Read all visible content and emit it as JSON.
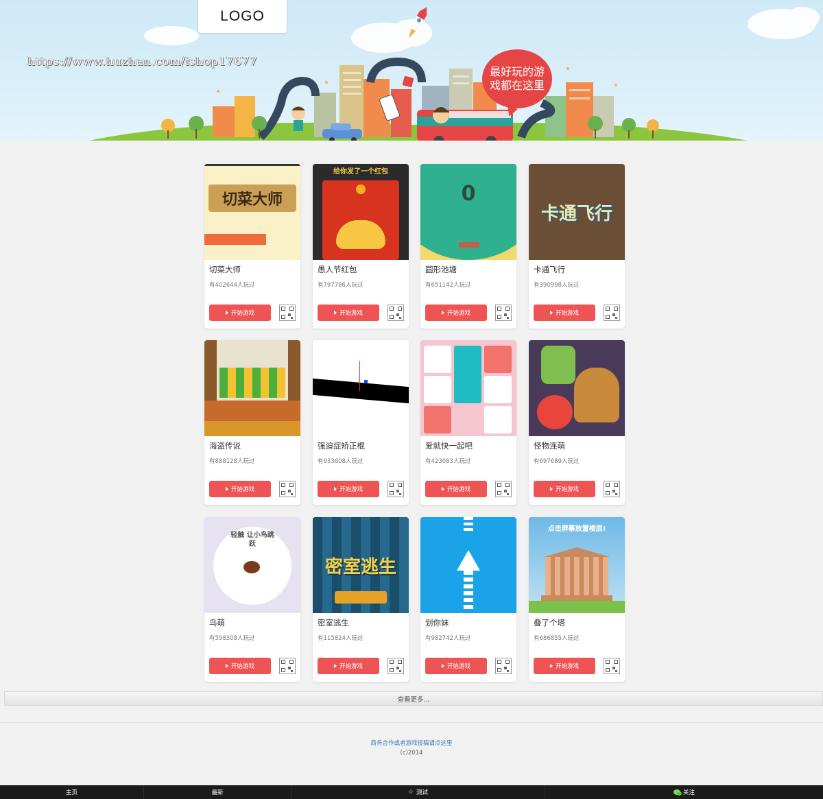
{
  "header": {
    "logo_text": "LOGO",
    "watermark": "https://www.huzhan.com/ishop17677",
    "slogan": "最好玩的游戏都在这里"
  },
  "colors": {
    "accent_red": "#ee5454",
    "banner_sky": "#d9eff9",
    "nav_bg": "#1b1b1b"
  },
  "games": [
    {
      "title": "切菜大师",
      "plays": "有402644人玩过",
      "button": "开始游戏",
      "thumb_text": "切菜大师"
    },
    {
      "title": "愚人节红包",
      "plays": "有797786人玩过",
      "button": "开始游戏",
      "thumb_text": "给你发了一个红包"
    },
    {
      "title": "圆形池塘",
      "plays": "有651142人玩过",
      "button": "开始游戏",
      "thumb_text": "0"
    },
    {
      "title": "卡通飞行",
      "plays": "有390998人玩过",
      "button": "开始游戏",
      "thumb_text": "卡通飞行"
    },
    {
      "title": "海盗传说",
      "plays": "有888128人玩过",
      "button": "开始游戏",
      "thumb_text": ""
    },
    {
      "title": "强迫症矫正棍",
      "plays": "有933608人玩过",
      "button": "开始游戏",
      "thumb_text": ""
    },
    {
      "title": "爱就快一起吧",
      "plays": "有423083人玩过",
      "button": "开始游戏",
      "thumb_text": ""
    },
    {
      "title": "怪物连萌",
      "plays": "有697689人玩过",
      "button": "开始游戏",
      "thumb_text": ""
    },
    {
      "title": "鸟萌",
      "plays": "有598308人玩过",
      "button": "开始游戏",
      "thumb_text": "轻触 让小鸟跳跃"
    },
    {
      "title": "密室逃生",
      "plays": "有115824人玩过",
      "button": "开始游戏",
      "thumb_text": "密室逃生"
    },
    {
      "title": "划你妹",
      "plays": "有982742人玩过",
      "button": "开始游戏",
      "thumb_text": ""
    },
    {
      "title": "叠了个塔",
      "plays": "有686855人玩过",
      "button": "开始游戏",
      "thumb_text": "点击屏幕放置楼层!"
    }
  ],
  "load_more": "查看更多...",
  "footer": {
    "link": "商务合作或者游戏投稿请点这里",
    "copyright": "(c)2014"
  },
  "bottom_nav": [
    {
      "label": "主页",
      "icon": "home"
    },
    {
      "label": "最新",
      "icon": "new"
    },
    {
      "label": "测试",
      "icon": "star-icon"
    },
    {
      "label": "关注",
      "icon": "wechat-icon"
    }
  ]
}
